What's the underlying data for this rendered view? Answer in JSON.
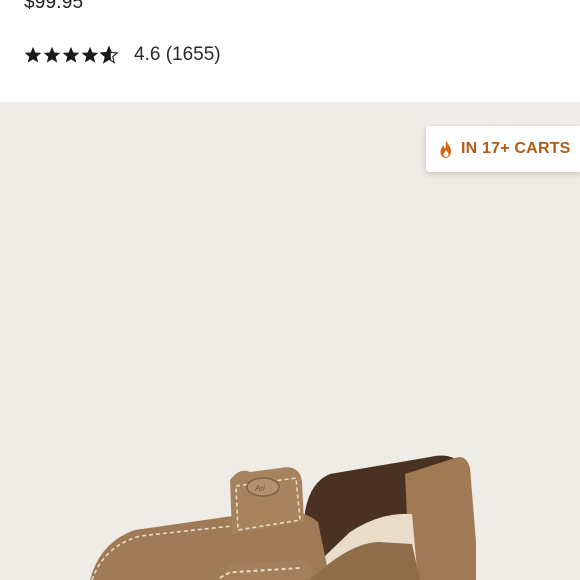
{
  "product": {
    "price": "$99.95",
    "rating": {
      "value": 4.6,
      "text": "4.6 (1655)",
      "stars_filled": 4.6,
      "stars_total": 5
    }
  },
  "badge": {
    "label": "IN 17+ CARTS",
    "icon": "flame-icon",
    "color": "#b45a14"
  },
  "image": {
    "alt": "Brown suede slip-on shoe",
    "background": "#efebe6"
  }
}
